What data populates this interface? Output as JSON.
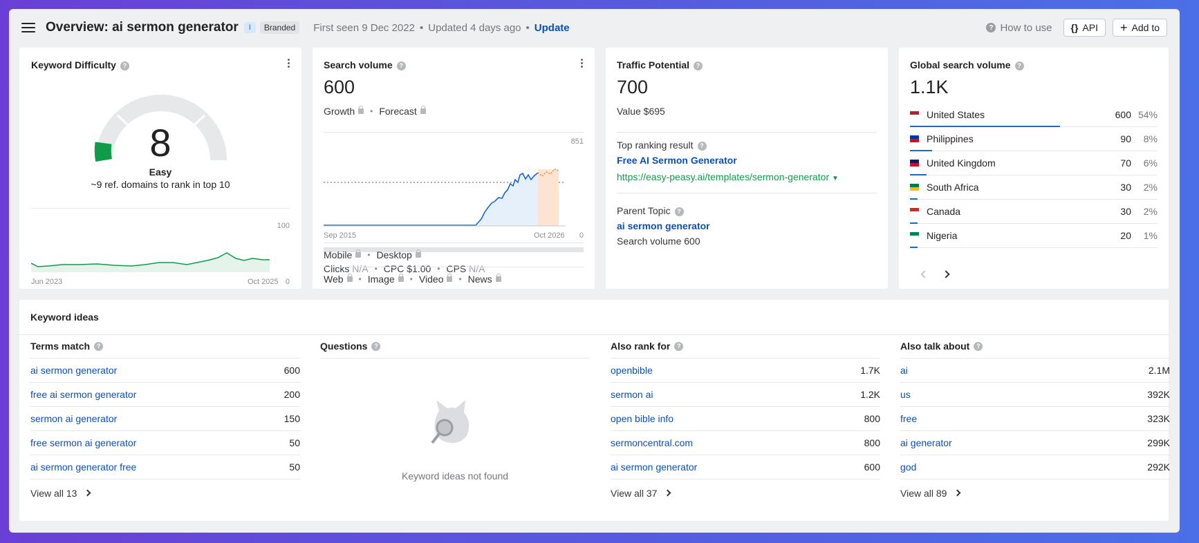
{
  "header": {
    "title": "Overview: ai sermon generator",
    "intent_badge": "I",
    "branded_badge": "Branded",
    "first_seen": "First seen 9 Dec 2022",
    "updated": "Updated 4 days ago",
    "update_label": "Update",
    "how_to_use": "How to use",
    "api_label": "API",
    "add_to_label": "Add to"
  },
  "kd": {
    "title": "Keyword Difficulty",
    "score": "8",
    "score_value": 8,
    "label": "Easy",
    "subtitle": "~9 ref. domains to rank in top 10",
    "chart_start": "Jun 2023",
    "chart_end": "Oct 2025",
    "y_max": "100",
    "y_min": "0"
  },
  "sv": {
    "title": "Search volume",
    "value": "600",
    "growth": "Growth",
    "forecast": "Forecast",
    "chart_start": "Sep 2015",
    "chart_end": "Oct 2026",
    "y_max": "851",
    "y_min": "0",
    "clicks_label": "Clicks",
    "clicks_value": "N/A",
    "cpc": "CPC $1.00",
    "cps_label": "CPS",
    "cps_value": "N/A",
    "mobile": "Mobile",
    "desktop": "Desktop",
    "web": "Web",
    "image": "Image",
    "video": "Video",
    "news": "News"
  },
  "tp": {
    "title": "Traffic Potential",
    "value": "700",
    "value_line": "Value $695",
    "top_ranking_label": "Top ranking result",
    "top_ranking_title": "Free AI Sermon Generator",
    "top_ranking_url": "https://easy-peasy.ai/templates/sermon-generator",
    "parent_topic_label": "Parent Topic",
    "parent_topic": "ai sermon generator",
    "parent_sv": "Search volume 600"
  },
  "gsv": {
    "title": "Global search volume",
    "value": "1.1K",
    "countries": [
      {
        "name": "United States",
        "value": "600",
        "pct": "54%",
        "share": 0.54
      },
      {
        "name": "Philippines",
        "value": "90",
        "pct": "8%",
        "share": 0.08
      },
      {
        "name": "United Kingdom",
        "value": "70",
        "pct": "6%",
        "share": 0.06
      },
      {
        "name": "South Africa",
        "value": "30",
        "pct": "2%",
        "share": 0.02
      },
      {
        "name": "Canada",
        "value": "30",
        "pct": "2%",
        "share": 0.02
      },
      {
        "name": "Nigeria",
        "value": "20",
        "pct": "1%",
        "share": 0.01
      }
    ]
  },
  "ideas": {
    "title": "Keyword ideas",
    "terms": {
      "label": "Terms match",
      "rows": [
        {
          "k": "ai sermon generator",
          "v": "600"
        },
        {
          "k": "free ai sermon generator",
          "v": "200"
        },
        {
          "k": "sermon ai generator",
          "v": "150"
        },
        {
          "k": "free sermon ai generator",
          "v": "50"
        },
        {
          "k": "ai sermon generator free",
          "v": "50"
        }
      ],
      "view_all": "View all 13"
    },
    "questions": {
      "label": "Questions",
      "empty": "Keyword ideas not found"
    },
    "also_rank": {
      "label": "Also rank for",
      "rows": [
        {
          "k": "openbible",
          "v": "1.7K"
        },
        {
          "k": "sermon ai",
          "v": "1.2K"
        },
        {
          "k": "open bible info",
          "v": "800"
        },
        {
          "k": "sermoncentral.com",
          "v": "800"
        },
        {
          "k": "ai sermon generator",
          "v": "600"
        }
      ],
      "view_all": "View all 37"
    },
    "also_talk": {
      "label": "Also talk about",
      "rows": [
        {
          "k": "ai",
          "v": "2.1M"
        },
        {
          "k": "us",
          "v": "392K"
        },
        {
          "k": "free",
          "v": "323K"
        },
        {
          "k": "ai generator",
          "v": "299K"
        },
        {
          "k": "god",
          "v": "292K"
        }
      ],
      "view_all": "View all 89"
    }
  },
  "colors": {
    "accent": "#0b4fb3",
    "kd_green": "#0f9b48",
    "bar_blue": "#1769d2"
  }
}
